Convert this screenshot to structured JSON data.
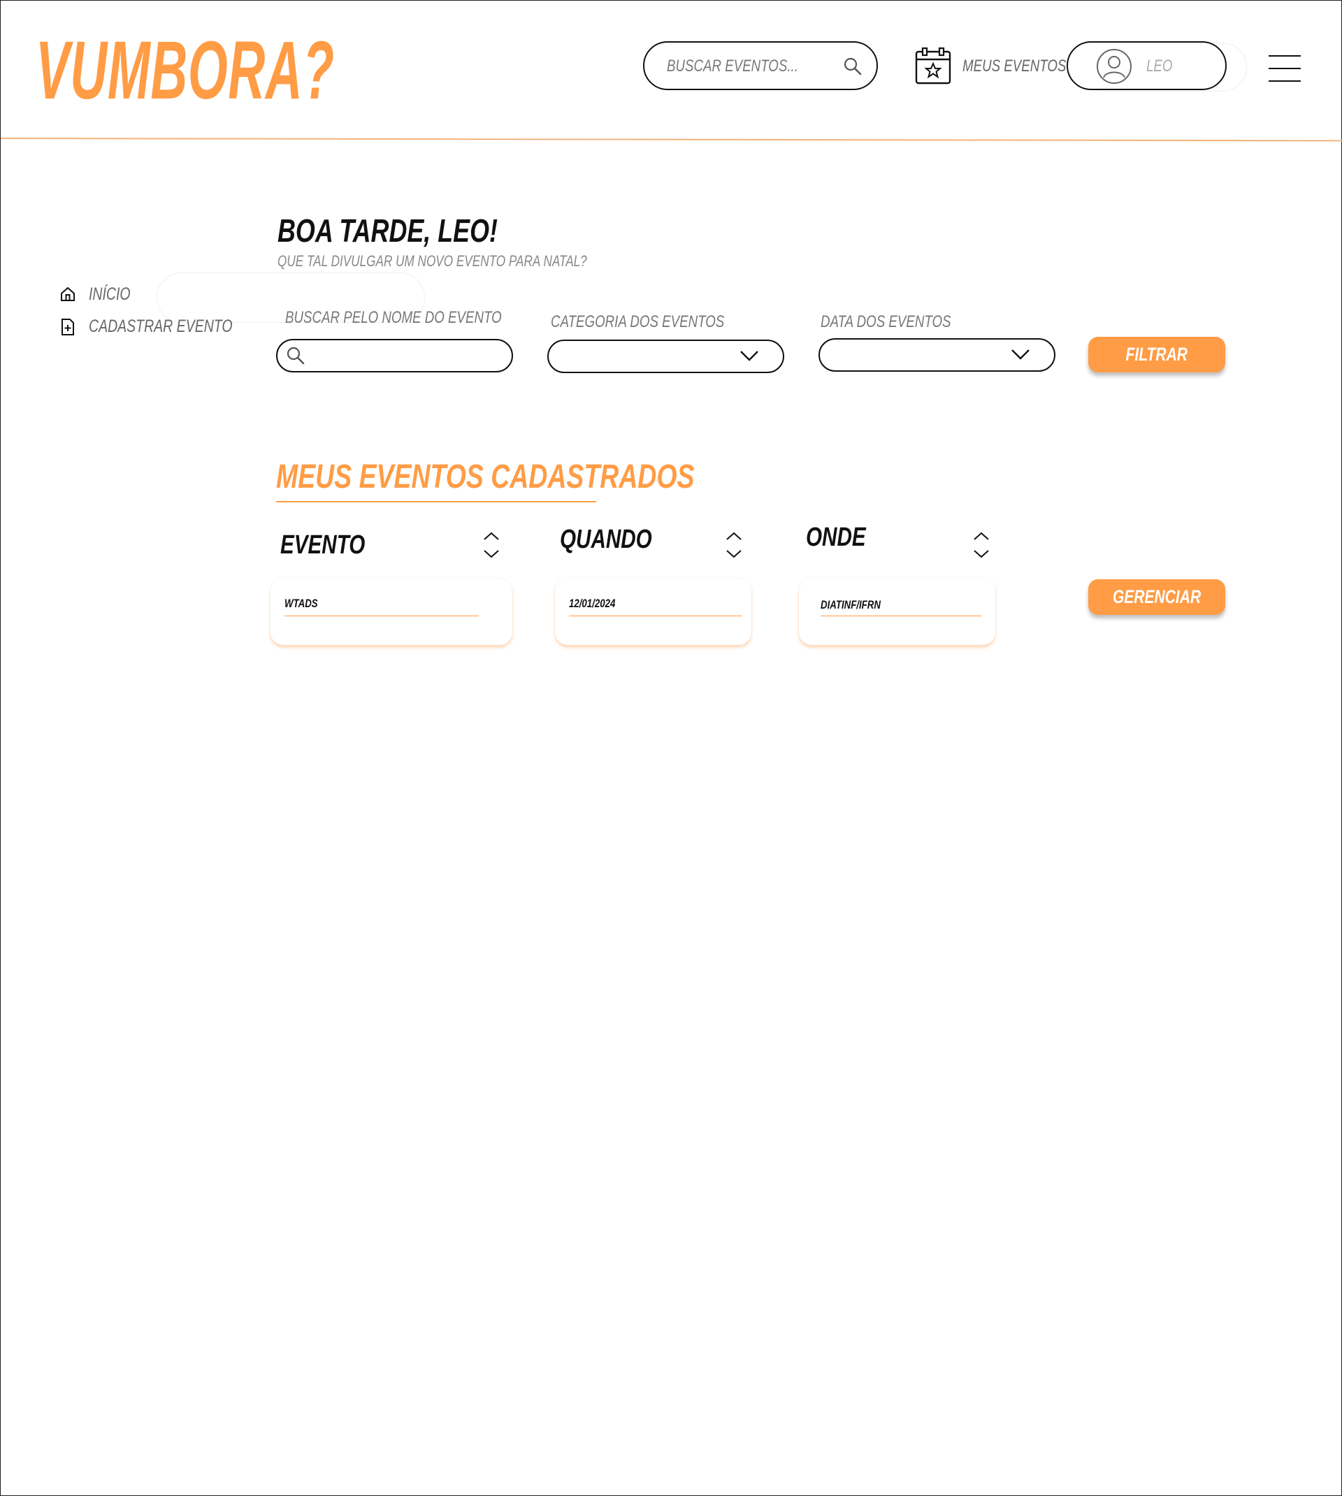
{
  "header": {
    "logo": "VUMBORA?",
    "search_placeholder": "BUSCAR EVENTOS...",
    "my_events_label": "MEUS EVENTOS",
    "user_name": "LEO"
  },
  "sidebar": {
    "items": [
      {
        "label": "INÍCIO",
        "icon": "home-icon"
      },
      {
        "label": "CADASTRAR EVENTO",
        "icon": "file-plus-icon"
      }
    ]
  },
  "main": {
    "greeting": "BOA TARDE, LEO!",
    "subtitle": "QUE TAL DIVULGAR UM NOVO EVENTO PARA NATAL?",
    "filters": {
      "name_label": "BUSCAR PELO NOME DO EVENTO",
      "category_label": "CATEGORIA DOS EVENTOS",
      "date_label": "DATA DOS EVENTOS",
      "filter_button": "FILTRAR"
    },
    "section_title": "MEUS EVENTOS CADASTRADOS",
    "table": {
      "columns": [
        "EVENTO",
        "QUANDO",
        "ONDE"
      ],
      "row": {
        "evento": "WTADS",
        "quando": "12/01/2024",
        "onde": "DIATINF/IFRN"
      },
      "manage_button": "GERENCIAR"
    }
  },
  "colors": {
    "accent": "#ff9c45",
    "text": "#111111",
    "muted": "#777777"
  }
}
